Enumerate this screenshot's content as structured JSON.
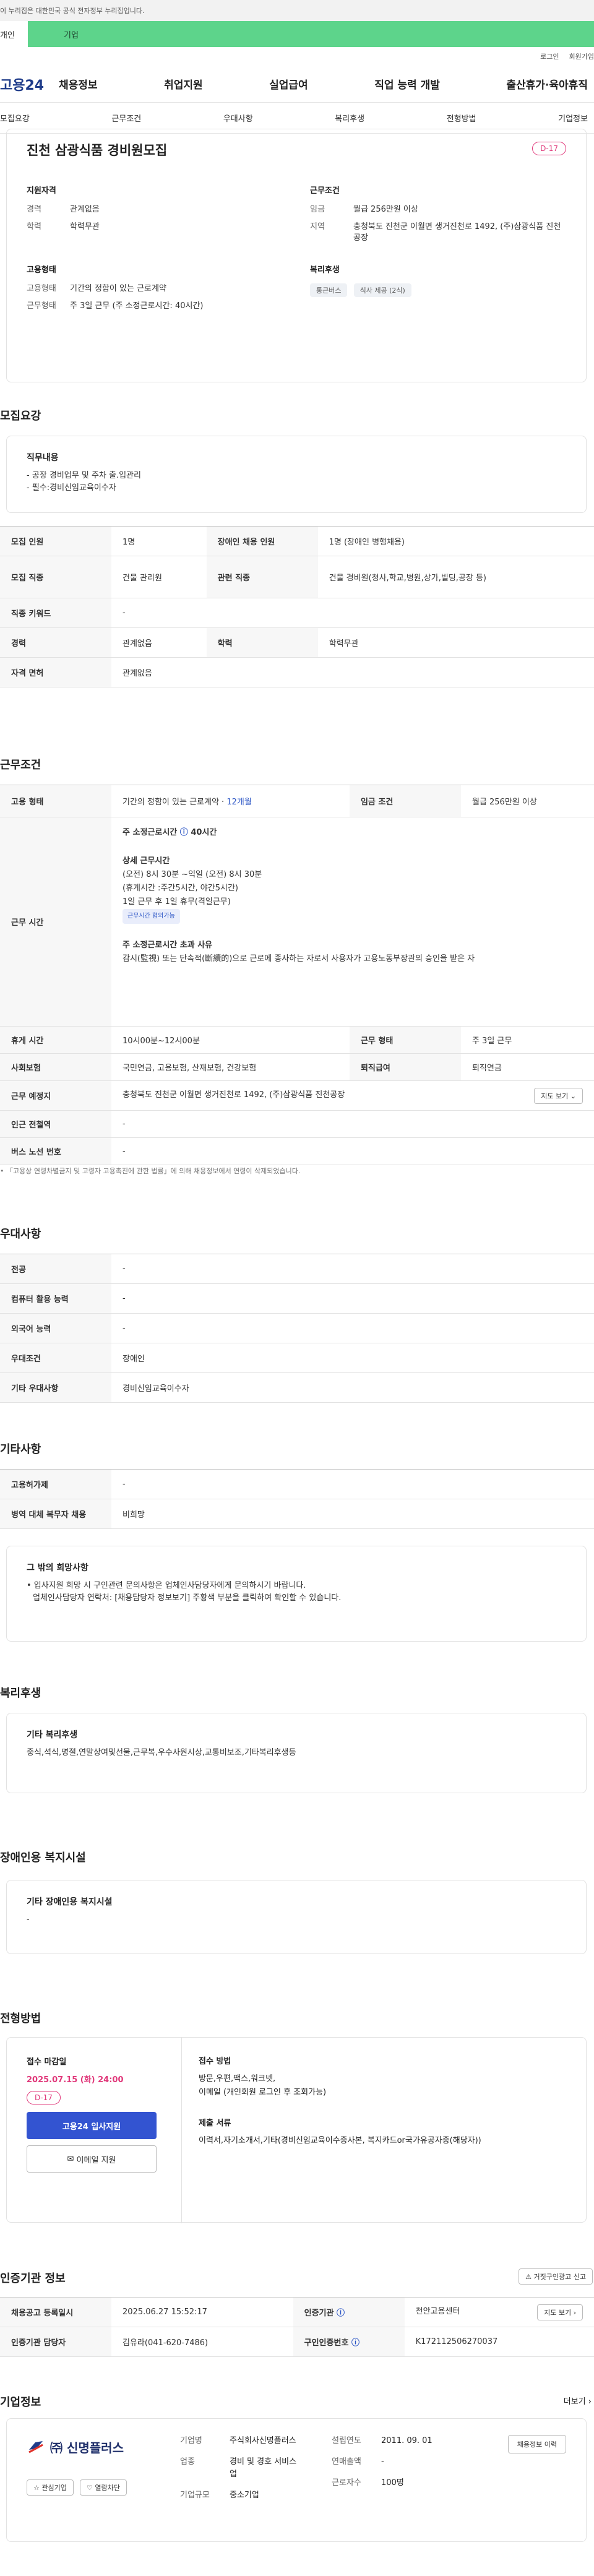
{
  "top": {
    "notice": "이 누리집은 대한민국 공식 전자정부 누리집입니다.",
    "mode_personal": "개인",
    "mode_company": "기업"
  },
  "util": {
    "login": "로그인",
    "join": "회원가입"
  },
  "logo": "고용24",
  "gnb": [
    "채용정보",
    "취업지원",
    "실업급여",
    "직업 능력 개발",
    "출산휴가·육아휴직"
  ],
  "anchors": [
    "모집요강",
    "근무조건",
    "우대사항",
    "복리후생",
    "전형방법",
    "기업정보"
  ],
  "header": {
    "title": "진천 삼광식품 경비원모집",
    "dday": "D-17",
    "qual_title": "지원자격",
    "qual": [
      {
        "k": "경력",
        "v": "관계없음"
      },
      {
        "k": "학력",
        "v": "학력무관"
      }
    ],
    "emp_title": "고용형태",
    "emp": [
      {
        "k": "고용형태",
        "v": "기간의 정함이 있는 근로계약"
      },
      {
        "k": "근무형태",
        "v": "주 3일 근무 (주 소정근로시간: 40시간)"
      }
    ],
    "cond_title": "근무조건",
    "cond": [
      {
        "k": "임금",
        "v": "월급 256만원 이상"
      },
      {
        "k": "지역",
        "v": "충청북도 진천군 이월면 생거진천로 1492, (주)삼광식품 진천공장"
      }
    ],
    "welfare_title": "복리후생",
    "welfare_chips": [
      "통근버스",
      "식사 제공 (2식)"
    ]
  },
  "recruit": {
    "title": "모집요강",
    "duty_title": "직무내용",
    "duty_lines": [
      "- 공장 경비업무 및 주차 출.입관리",
      "- 필수:경비신임교육이수자"
    ],
    "rows": [
      {
        "k1": "모집 인원",
        "v1": "1명",
        "k2": "장애인 채용 인원",
        "v2": "1명 (장애인 병행채용)"
      },
      {
        "k1": "모집 직종",
        "v1": "건물 관리원",
        "k2": "관련 직종",
        "v2": "건물 경비원(청사,학교,병원,상가,빌딩,공장 등)"
      },
      {
        "k1": "직종 키워드",
        "v1": "-"
      },
      {
        "k1": "경력",
        "v1": "관계없음",
        "k2": "학력",
        "v2": "학력무관"
      },
      {
        "k1": "자격 면허",
        "v1": "관계없음"
      }
    ]
  },
  "work": {
    "title": "근무조건",
    "type_k": "고용 형태",
    "type_v": "기간의 정함이 있는 근로계약 · ",
    "type_period": "12개월",
    "wage_k": "임금 조건",
    "wage_v": "월급 256만원 이상",
    "time_k": "근무 시간",
    "weekly_label": "주 소정근로시간",
    "weekly_value": "40시간",
    "detail_title": "상세 근무시간",
    "detail_lines": [
      "(오전) 8시 30분 ~익일 (오전) 8시 30분",
      "(휴게시간 :주간5시간, 야간5시간)",
      "1일 근무 후 1일 휴무(격일근무)"
    ],
    "shift_tag": "근무시간 협의가능",
    "excess_title": "주 소정근로시간 초과 사유",
    "excess_text": "감시(監視) 또는 단속적(斷續的)으로 근로에 종사하는 자로서 사용자가 고용노동부장관의 승인을 받은 자",
    "break_k": "휴게 시간",
    "break_v": "10시00분~12시00분",
    "form_k": "근무 형태",
    "form_v": "주 3일 근무",
    "ins_k": "사회보험",
    "ins_v": "국민연금, 고용보험, 산재보험, 건강보험",
    "ret_k": "퇴직급여",
    "ret_v": "퇴직연금",
    "place_k": "근무 예정지",
    "place_v": "충청북도 진천군 이월면 생거진천로 1492, (주)삼광식품 진천공장",
    "map_btn": "지도 보기",
    "subway_k": "인근 전철역",
    "subway_v": "-",
    "bus_k": "버스 노선 번호",
    "bus_v": "-",
    "notice": "「고용상 연령차별금지 및 고령자 고용촉진에 관한 법률」에 의해 채용정보에서 연령이 삭제되었습니다."
  },
  "prefer": {
    "title": "우대사항",
    "rows": [
      {
        "k": "전공",
        "v": "-"
      },
      {
        "k": "컴퓨터 활용 능력",
        "v": "-"
      },
      {
        "k": "외국어 능력",
        "v": "-"
      },
      {
        "k": "우대조건",
        "v": "장애인"
      },
      {
        "k": "기타 우대사항",
        "v": "경비신임교육이수자"
      }
    ]
  },
  "etc": {
    "title": "기타사항",
    "rows": [
      {
        "k": "고용허가제",
        "v": "-"
      },
      {
        "k": "병역 대체 복무자 채용",
        "v": "비희망"
      }
    ],
    "box_title": "그 밖의 희망사항",
    "box_line1": "• 입사지원 희망 시 구인관련 문의사항은 업체인사담당자에게 문의하시기 바랍니다.",
    "box_line2": "업체인사담당자 연락처: [채용담당자 정보보기] 주황색 부분을 클릭하여 확인할 수 있습니다."
  },
  "welfare": {
    "title": "복리후생",
    "box_title": "기타 복리후생",
    "text": "중식,석식,명절,연말상여및선물,근무복,우수사원시상,교통비보조,기타복리후생등"
  },
  "disab": {
    "title": "장애인용 복지시설",
    "box_title": "기타 장애인용 복지시설",
    "text": "-"
  },
  "apply": {
    "title": "전형방법",
    "deadline_label": "접수 마감일",
    "deadline": "2025.07.15 (화) 24:00",
    "dday": "D-17",
    "apply_btn": "고용24 입사지원",
    "email_btn": "이메일 지원",
    "method_label": "접수 방법",
    "method_text1": "방문,우편,팩스,워크넷,",
    "method_text2": "이메일 (개인회원 로그인 후 조회가능)",
    "docs_label": "제출 서류",
    "docs_text": "이력서,자기소개서,기타(경비신임교육이수증사본, 복지카드or국가유공자증(해당자))"
  },
  "auth": {
    "title": "인증기관 정보",
    "report_btn": "거짓구인광고 신고",
    "rows": [
      {
        "k1": "채용공고 등록일시",
        "v1": "2025.06.27 15:52:17",
        "k2": "인증기관",
        "v2": "천안고용센터"
      },
      {
        "k1": "인증기관 담당자",
        "v1": "김유라(041-620-7486)",
        "k2": "구인인증번호",
        "v2": "K172112506270037"
      }
    ],
    "map_btn": "지도 보기"
  },
  "company": {
    "title": "기업정보",
    "more": "더보기",
    "name": "㈜ 신명플러스",
    "fav_btn": "관심기업",
    "follow_btn": "열람차단",
    "info_btn": "채용정보 이력",
    "fields": [
      {
        "k": "기업명",
        "v": "주식회사신명플러스"
      },
      {
        "k": "업종",
        "v": "경비 및 경호 서비스업"
      },
      {
        "k": "기업규모",
        "v": "중소기업"
      }
    ],
    "fields2": [
      {
        "k": "설립연도",
        "v": "2011. 09. 01"
      },
      {
        "k": "연매출액",
        "v": "-"
      },
      {
        "k": "근로자수",
        "v": "100명"
      }
    ]
  }
}
